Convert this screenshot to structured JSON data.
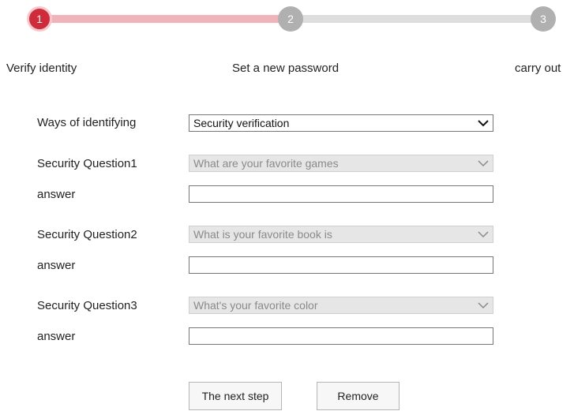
{
  "stepper": {
    "steps": [
      {
        "number": "1",
        "label": "Verify identity",
        "state": "active"
      },
      {
        "number": "2",
        "label": "Set a new password",
        "state": "inactive"
      },
      {
        "number": "3",
        "label": "carry out",
        "state": "inactive"
      }
    ],
    "colors": {
      "active_circle": "#d12a3a",
      "active_track": "#f1b3b8",
      "inactive_circle": "#b0b0b0",
      "inactive_track": "#dedede"
    }
  },
  "form": {
    "identify_method": {
      "label": "Ways of identifying",
      "selected": "Security verification",
      "icon": "chevron-down-icon"
    },
    "questions": [
      {
        "label": "Security Question1",
        "selected": "What are your favorite games",
        "answer_label": "answer",
        "answer_value": ""
      },
      {
        "label": "Security Question2",
        "selected": "What is your favorite book is",
        "answer_label": "answer",
        "answer_value": ""
      },
      {
        "label": "Security Question3",
        "selected": "What's your favorite color",
        "answer_label": "answer",
        "answer_value": ""
      }
    ]
  },
  "buttons": {
    "next_label": "The next step",
    "remove_label": "Remove"
  }
}
